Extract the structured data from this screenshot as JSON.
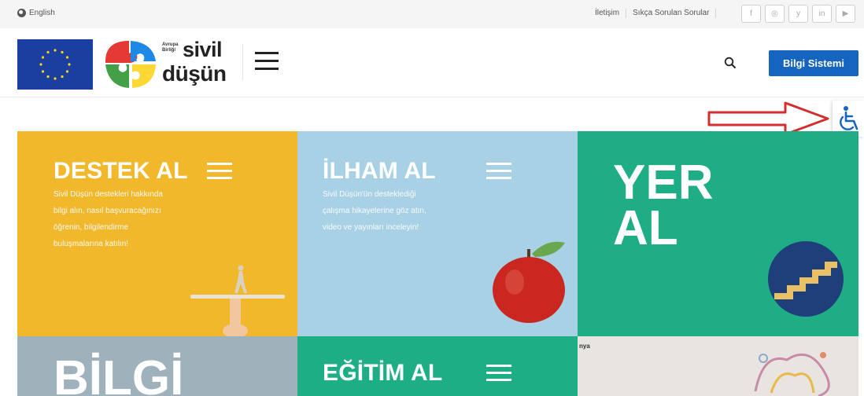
{
  "topbar": {
    "language": "English",
    "links": [
      "İletişim",
      "Sıkça Sorulan Sorular"
    ],
    "socials": [
      {
        "icon": "facebook-icon",
        "glyph": "f"
      },
      {
        "icon": "instagram-icon",
        "glyph": "◎"
      },
      {
        "icon": "twitter-icon",
        "glyph": "y"
      },
      {
        "icon": "linkedin-icon",
        "glyph": "in"
      },
      {
        "icon": "youtube-icon",
        "glyph": "▶"
      }
    ]
  },
  "header": {
    "logo_small": "Avrupa Birliği",
    "logo_line1": "sivil",
    "logo_line2": "düşün",
    "cta": "Bilgi Sistemi"
  },
  "tiles": {
    "destek": {
      "title": "DESTEK AL",
      "desc": [
        "Sivil Düşün destekleri hakkında",
        "bilgi alın, nasıl başvuracağınızı",
        "öğrenin, bilgilendirme",
        "buluşmalarına katılın!"
      ]
    },
    "ilham": {
      "title": "İLHAM AL",
      "desc": [
        "Sivil Düşün'ün desteklediği",
        "çalışma hikayelerine göz atın,",
        "video ve yayınları inceleyin!"
      ]
    },
    "yer": {
      "line1": "YER",
      "line2": "AL"
    },
    "bilgi": {
      "title": "BİLGİ"
    },
    "egitim": {
      "title": "EĞİTİM AL"
    },
    "extra": {
      "small": "nya"
    }
  },
  "colors": {
    "accent": "#1565c0",
    "yellow": "#f1b82c",
    "lightblue": "#a9d1e6",
    "green": "#1ead84",
    "arrow": "#d32f2f"
  }
}
